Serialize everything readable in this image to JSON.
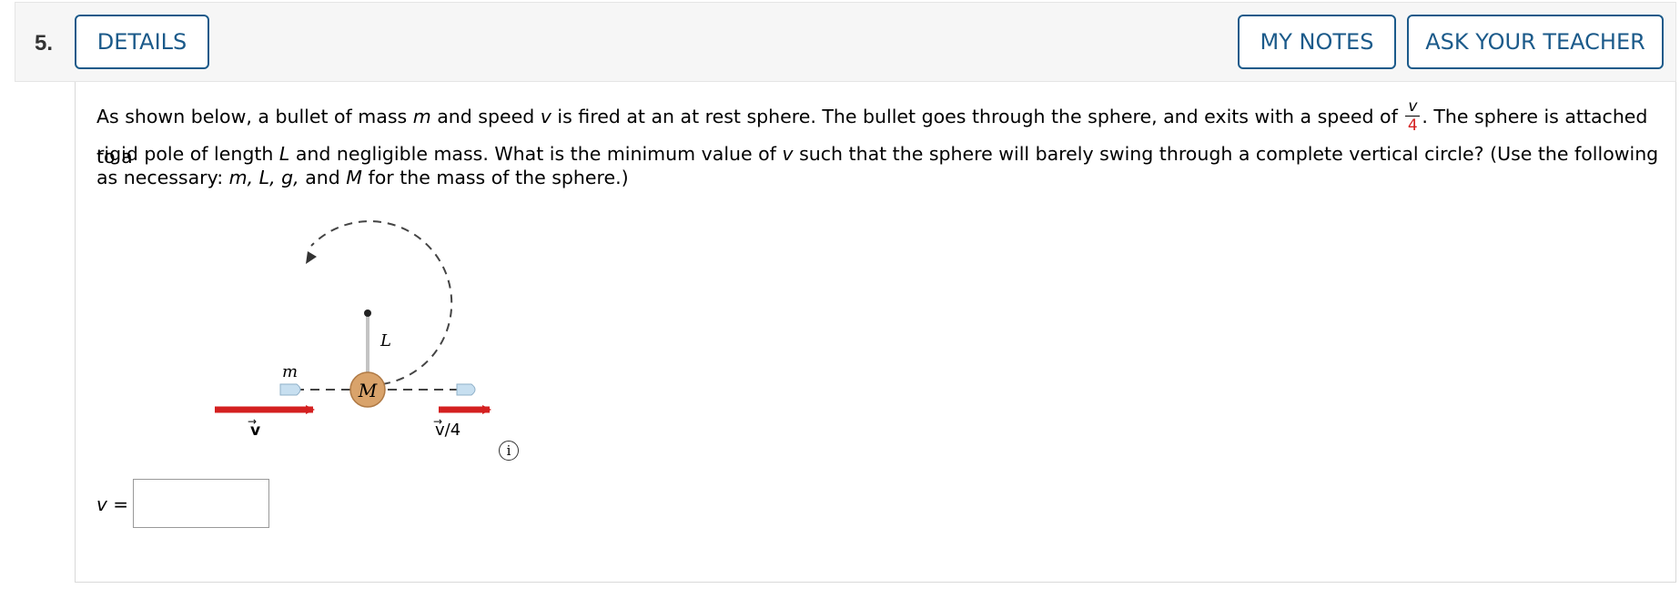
{
  "question": {
    "number": "5.",
    "buttons": {
      "details": "DETAILS",
      "my_notes": "MY NOTES",
      "ask_teacher": "ASK YOUR TEACHER"
    },
    "text_part1": "As shown below, a bullet of mass ",
    "var_m": "m",
    "text_part2": " and speed ",
    "var_v": "v",
    "text_part3": " is fired at an at rest sphere. The bullet goes through the sphere, and exits with a speed of ",
    "frac_num": "v",
    "frac_den": "4",
    "text_part4": ". The sphere is attached to a",
    "text_line2a": "rigid pole of length ",
    "var_L": "L",
    "text_line2b": " and negligible mass. What is the minimum value of ",
    "var_v2": "v",
    "text_line2c": " such that the sphere will barely swing through a complete vertical circle? (Use the following as necessary: ",
    "vars_list": "m, L, g,",
    "text_and": " and ",
    "var_M": "M",
    "text_line2d": " for the mass of the sphere.)",
    "answer_label": "v =",
    "info_symbol": "i"
  },
  "figure": {
    "label_m": "m",
    "label_L": "L",
    "label_M": "M",
    "label_v": "v",
    "label_v4": "v/4",
    "colors": {
      "arrow": "#d42020",
      "sphere": "#d9a36b",
      "bullet": "#c7dff0",
      "pole": "#cccccc"
    }
  },
  "colors": {
    "button_border": "#1b5a8a",
    "header_bg": "#f6f6f6",
    "red": "#d42020"
  }
}
